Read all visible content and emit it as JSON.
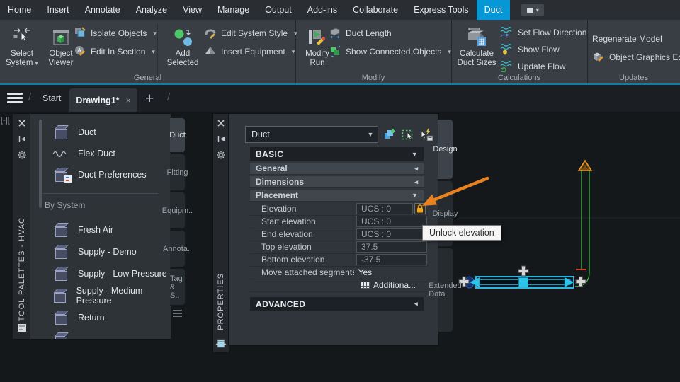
{
  "menubar": {
    "items": [
      "Home",
      "Insert",
      "Annotate",
      "Analyze",
      "View",
      "Manage",
      "Output",
      "Add-ins",
      "Collaborate",
      "Express Tools",
      "Duct"
    ],
    "active_item": "Duct"
  },
  "ribbon": {
    "general": {
      "panel_label": "General",
      "select_system": "Select System",
      "object_viewer": "Object Viewer",
      "isolate_objects": "Isolate Objects",
      "edit_in_section": "Edit In Section",
      "add_selected": "Add Selected",
      "edit_system_style": "Edit System Style",
      "insert_equipment": "Insert Equipment"
    },
    "modify": {
      "panel_label": "Modify",
      "modify_run": "Modify Run",
      "duct_length": "Duct Length",
      "show_connected_objects": "Show Connected Objects"
    },
    "calculations": {
      "panel_label": "Calculations",
      "calculate_duct_sizes": "Calculate Duct Sizes",
      "set_flow_direction": "Set Flow Direction",
      "show_flow": "Show Flow",
      "update_flow": "Update Flow"
    },
    "updates": {
      "panel_label": "Updates",
      "regenerate_model": "Regenerate Model",
      "object_graphics_edit": "Object Graphics Edit"
    }
  },
  "file_tabs": {
    "start": "Start",
    "active_tab": "Drawing1*",
    "close": "×",
    "new_tab": "+"
  },
  "viewport_control": "[-][",
  "tool_palettes": {
    "title": "TOOL PALETTES - HVAC",
    "tools": [
      {
        "label": "Duct"
      },
      {
        "label": "Flex Duct"
      },
      {
        "label": "Duct Preferences"
      }
    ],
    "group_label": "By System",
    "systems": [
      {
        "label": "Fresh Air"
      },
      {
        "label": "Supply - Demo"
      },
      {
        "label": "Supply - Low Pressure"
      },
      {
        "label": "Supply - Medium Pressure"
      },
      {
        "label": "Return"
      }
    ],
    "side_tabs": [
      "Duct",
      "Fitting",
      "Equipm..",
      "Annota..",
      "Tag & S.."
    ],
    "active_side_tab": "Duct"
  },
  "properties": {
    "title": "PROPERTIES",
    "selector_value": "Duct",
    "basic_section": "BASIC",
    "advanced_section": "ADVANCED",
    "subsections": [
      "General",
      "Dimensions",
      "Placement"
    ],
    "rows": [
      {
        "label": "Elevation",
        "value": "UCS : 0"
      },
      {
        "label": "Start elevation",
        "value": "UCS : 0"
      },
      {
        "label": "End elevation",
        "value": "UCS : 0"
      },
      {
        "label": "Top elevation",
        "value": "37.5"
      },
      {
        "label": "Bottom elevation",
        "value": "-37.5"
      },
      {
        "label": "Move attached segments",
        "value": "Yes"
      },
      {
        "label": "",
        "value": "Additiona..."
      }
    ],
    "side_tabs": [
      "Design",
      "Display",
      "Extended Data"
    ],
    "active_side_tab": "Design"
  },
  "tooltip": "Unlock elevation",
  "colors": {
    "accent_blue": "#0697d6",
    "ribbon_edge": "#0d7ea8",
    "annotation_orange": "#e8811f",
    "lock_orange": "#f2a71f",
    "duct_green": "#3da93f",
    "selection_cyan": "#2ac4ea",
    "grip_red": "#d93a2b"
  }
}
